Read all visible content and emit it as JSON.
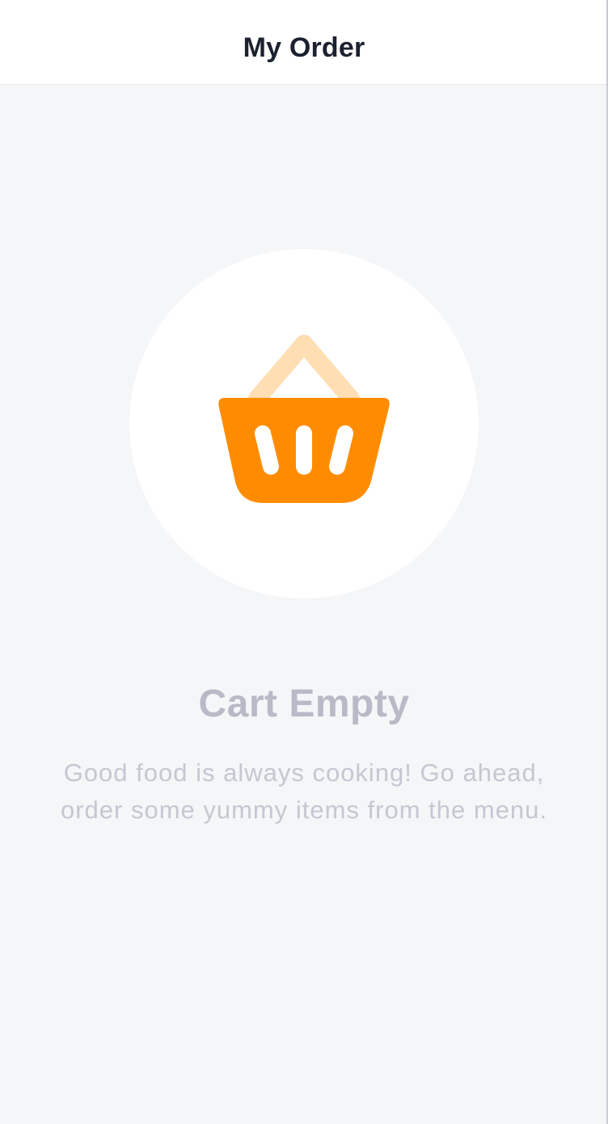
{
  "header": {
    "title": "My Order"
  },
  "empty_state": {
    "icon": "shopping-basket-icon",
    "title": "Cart Empty",
    "message": "Good food is always cooking! Go ahead, order some yummy items from the menu."
  },
  "colors": {
    "accent": "#ff8c00",
    "accent_light": "#ffdeb3",
    "page_background": "#f5f6f8",
    "muted_text": "#b8bac7"
  }
}
